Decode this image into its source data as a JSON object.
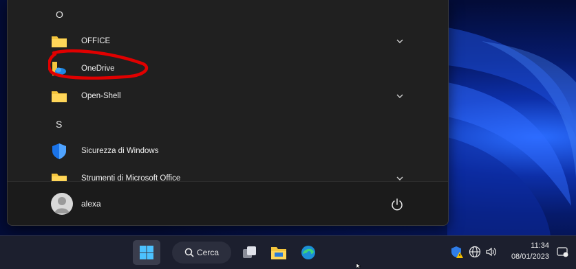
{
  "start_menu": {
    "sections": [
      {
        "letter": "O"
      },
      {
        "letter": "S"
      }
    ],
    "apps": [
      {
        "label": "OFFICE",
        "icon": "folder-icon",
        "expandable": true
      },
      {
        "label": "OneDrive",
        "icon": "onedrive-icon",
        "expandable": false
      },
      {
        "label": "Open-Shell",
        "icon": "folder-icon",
        "expandable": true
      },
      {
        "label": "Sicurezza di Windows",
        "icon": "windows-security-shield-icon",
        "expandable": false
      },
      {
        "label": "Strumenti di Microsoft Office",
        "icon": "folder-icon",
        "expandable": true
      }
    ],
    "user": {
      "name": "alexa"
    }
  },
  "taskbar": {
    "search_label": "Cerca",
    "pinned": [
      "start-icon",
      "task-view-icon",
      "file-explorer-icon",
      "edge-icon"
    ],
    "tray": {
      "time": "11:34",
      "date": "08/01/2023",
      "icons": [
        "security-warning-icon",
        "network-icon",
        "volume-icon",
        "notification-icon"
      ]
    }
  },
  "colors": {
    "menu_bg": "#202020",
    "folder_yellow": "#f4c53d",
    "highlight_red": "#e00000",
    "accent_blue": "#0078d4"
  }
}
